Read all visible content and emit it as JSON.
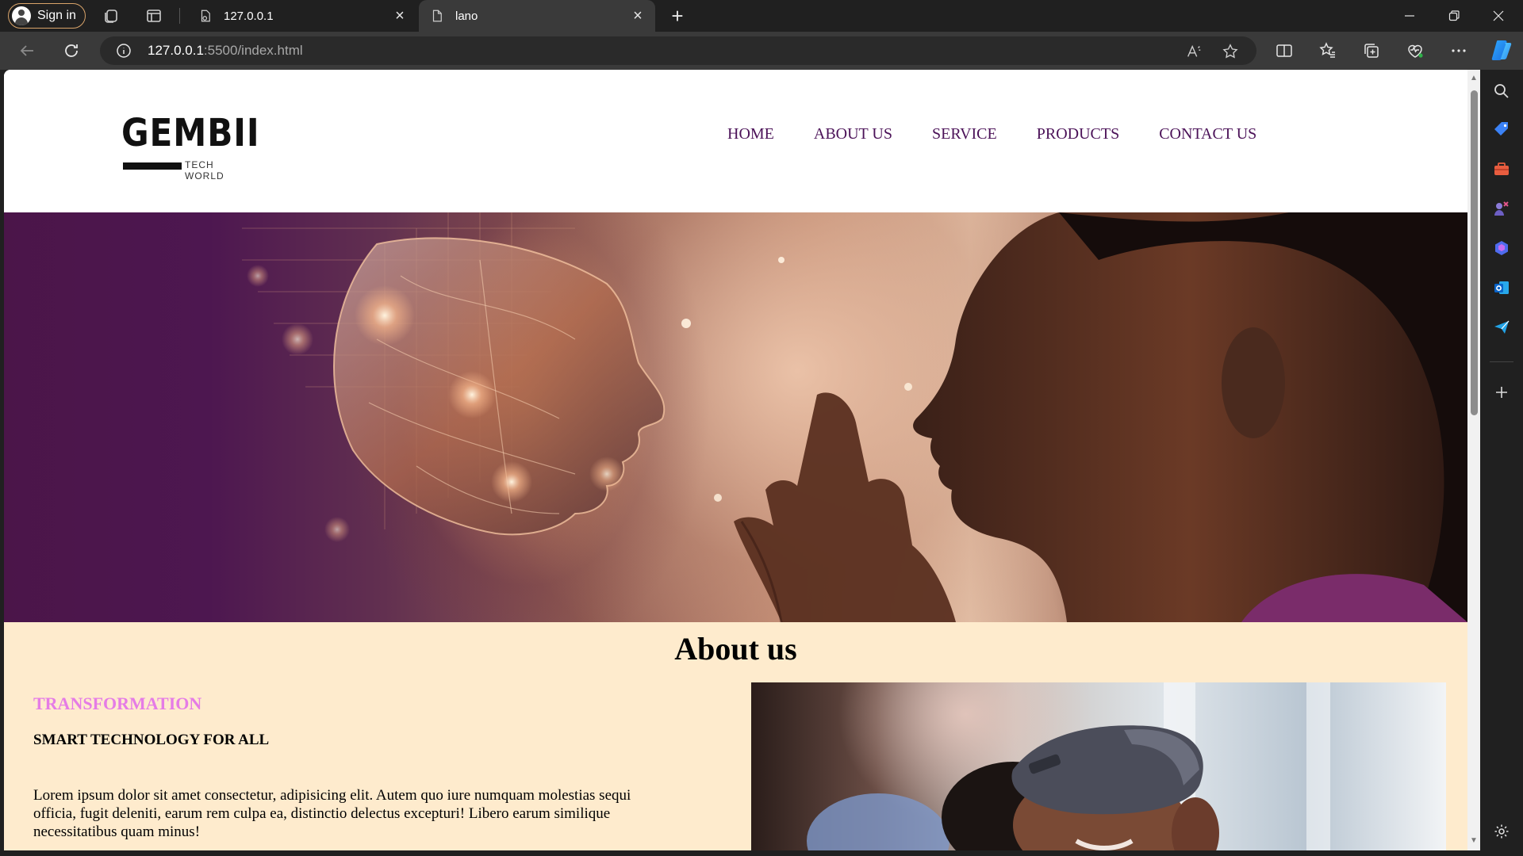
{
  "browser": {
    "profile_label": "Sign in",
    "tabs": [
      {
        "title": "127.0.0.1",
        "active": false
      },
      {
        "title": "lano",
        "active": true
      }
    ],
    "url_host": "127.0.0.1",
    "url_path": ":5500/index.html"
  },
  "site": {
    "logo_text": "GEMBII",
    "logo_tagline": "TECH WORLD",
    "nav": [
      "HOME",
      "ABOUT US",
      "SERVICE",
      "PRODUCTS",
      "CONTACT US"
    ],
    "nav_color": "#4b1258"
  },
  "about": {
    "title": "About us",
    "eyebrow": "TRANSFORMATION",
    "eyebrow_color": "#e57ce6",
    "subheading": "SMART TECHNOLOGY FOR ALL",
    "body": "Lorem ipsum dolor sit amet consectetur, adipisicing elit. Autem quo iure numquam molestias sequi officia, fugit deleniti, earum rem culpa ea, distinctio delectus excepturi! Libero earum similique necessitatibus quam minus!",
    "background": "#feebcd"
  }
}
